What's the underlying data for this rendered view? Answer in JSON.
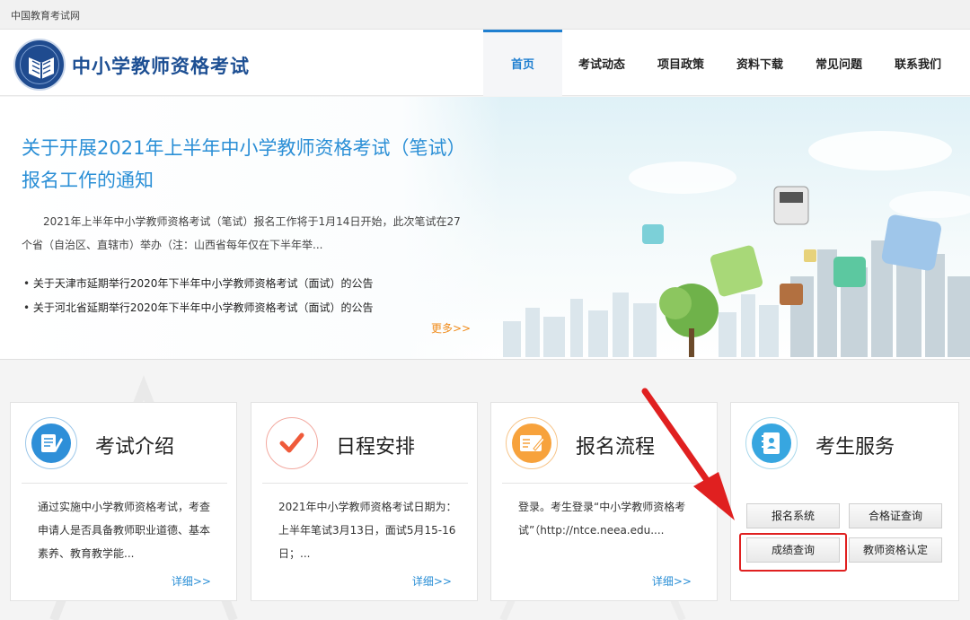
{
  "topbar": {
    "site_name": "中国教育考试网"
  },
  "header": {
    "title": "中小学教师资格考试",
    "nav": [
      {
        "label": "首页",
        "active": true
      },
      {
        "label": "考试动态",
        "active": false
      },
      {
        "label": "项目政策",
        "active": false
      },
      {
        "label": "资料下载",
        "active": false
      },
      {
        "label": "常见问题",
        "active": false
      },
      {
        "label": "联系我们",
        "active": false
      }
    ]
  },
  "banner": {
    "headline": "关于开展2021年上半年中小学教师资格考试（笔试）报名工作的通知",
    "summary": "2021年上半年中小学教师资格考试（笔试）报名工作将于1月14日开始，此次笔试在27个省（自治区、直辖市）举办（注：山西省每年仅在下半年举...",
    "links": [
      "关于天津市延期举行2020年下半年中小学教师资格考试（面试）的公告",
      "关于河北省延期举行2020年下半年中小学教师资格考试（面试）的公告"
    ],
    "more": "更多>>"
  },
  "cards": [
    {
      "title": "考试介绍",
      "text": "通过实施中小学教师资格考试，考查申请人是否具备教师职业道德、基本素养、教育教学能...",
      "more": "详细>>"
    },
    {
      "title": "日程安排",
      "text": "2021年中小学教师资格考试日期为：上半年笔试3月13日，面试5月15-16日；...",
      "more": "详细>>"
    },
    {
      "title": "报名流程",
      "text": "登录。考生登录“中小学教师资格考试”（http://ntce.neea.edu....",
      "more": "详细>>"
    }
  ],
  "services": {
    "title": "考生服务",
    "buttons": {
      "register": "报名系统",
      "certificate": "合格证查询",
      "score": "成绩查询",
      "qualification": "教师资格认定"
    }
  },
  "colors": {
    "accent": "#2b8fd6",
    "nav_active": "#1f7fd0",
    "annotation": "#e02020",
    "more": "#f08b1a"
  }
}
